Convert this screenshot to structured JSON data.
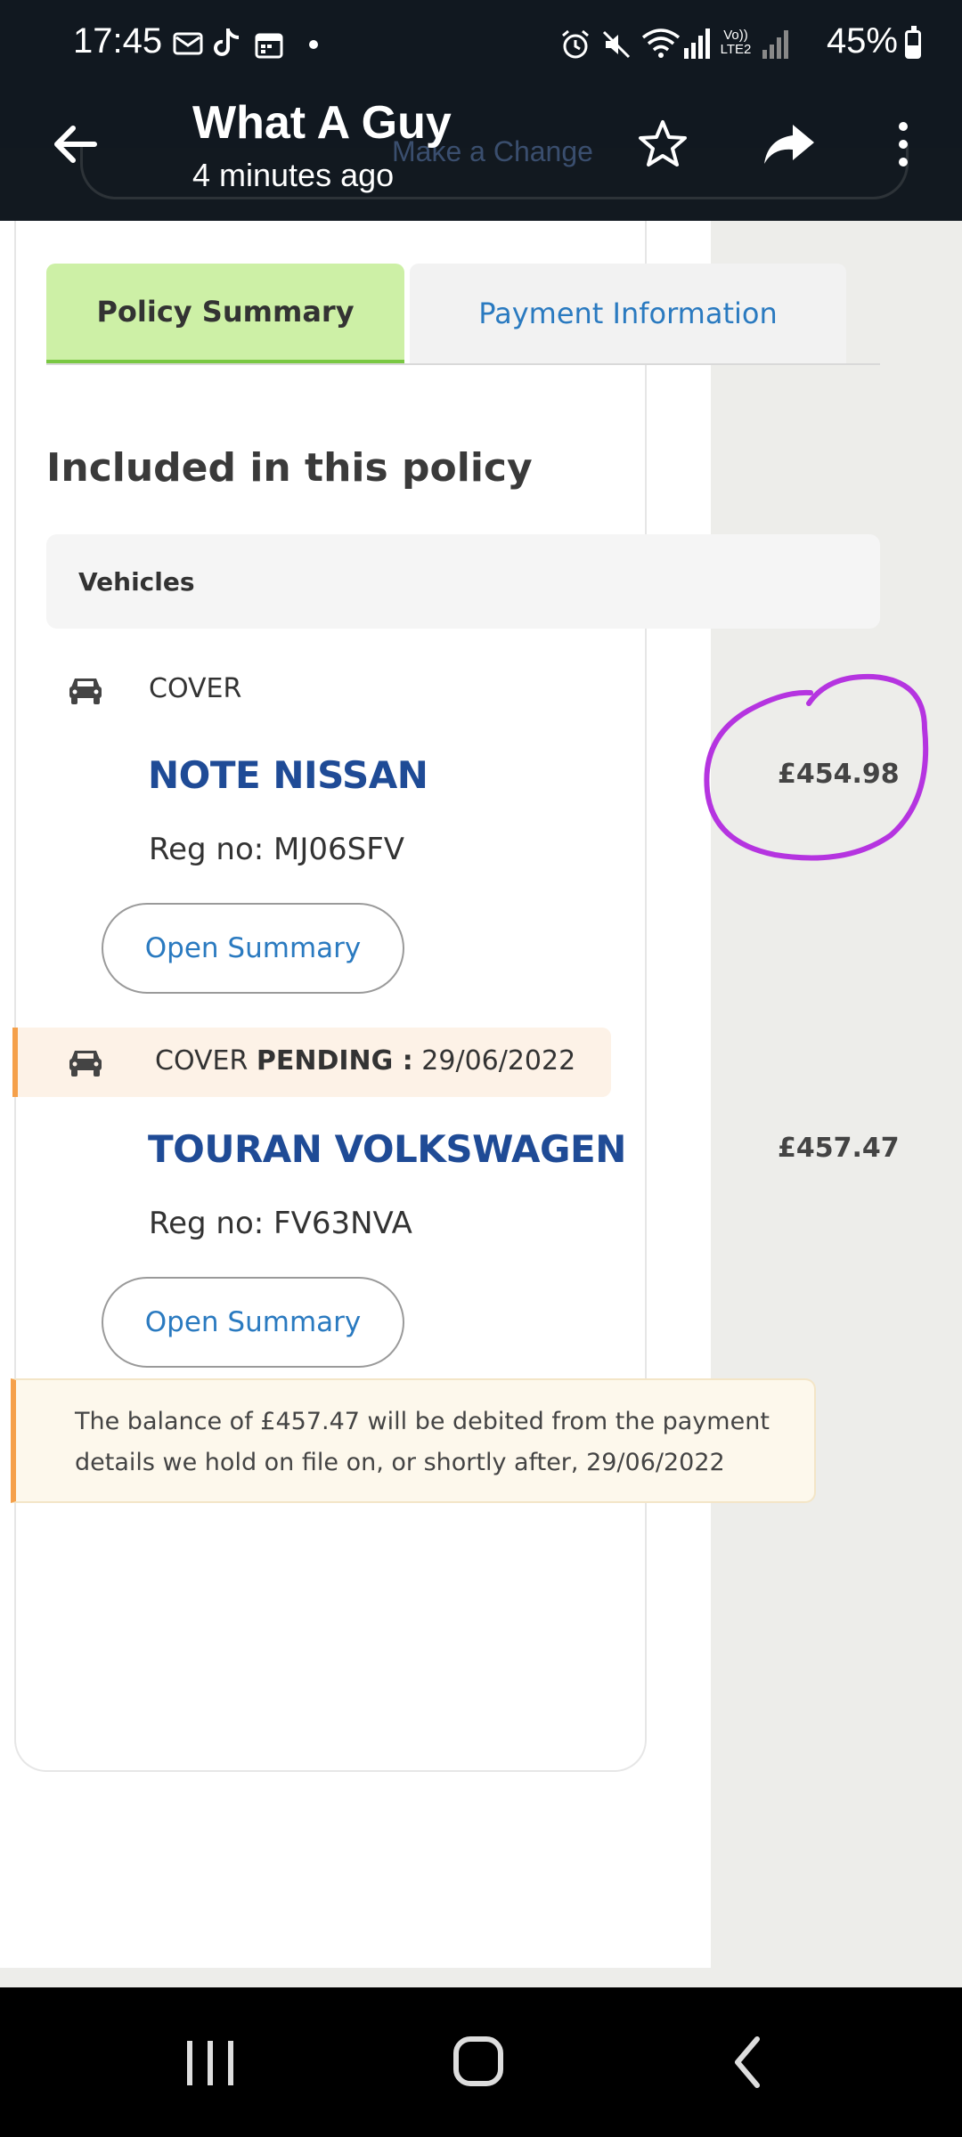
{
  "status_bar": {
    "time": "17:45",
    "battery_percent": "45%",
    "icons": [
      "mail-icon",
      "tiktok-icon",
      "calendar-icon",
      "dot-icon",
      "alarm-icon",
      "mute-icon",
      "wifi-icon",
      "signal-icon",
      "volte-icon",
      "signal-weak-icon",
      "battery-icon"
    ],
    "volte_label": "Vo)) LTE2",
    "battery_level": 0.45
  },
  "header": {
    "title": "What A Guy",
    "subtitle": "4 minutes ago",
    "behind_label": "Make a Change"
  },
  "tabs": [
    {
      "label": "Policy Summary",
      "active": true
    },
    {
      "label": "Payment Information",
      "active": false
    }
  ],
  "main": {
    "section_title": "Included in this policy",
    "vehicles_header": "Vehicles",
    "vehicles": [
      {
        "cover": "COVER",
        "name": "NOTE NISSAN",
        "reg": "Reg no: MJ06SFV",
        "button": "Open Summary",
        "price": "£454.98"
      },
      {
        "cover": "COVER",
        "pending_label": "PENDING :",
        "pending_date": "29/06/2022",
        "name": "TOURAN VOLKSWAGEN",
        "reg": "Reg no: FV63NVA",
        "button": "Open Summary",
        "price": "£457.47"
      }
    ],
    "notice_line1": "The balance of £457.47 will be debited from the payment",
    "notice_line2": "details we hold on file on, or shortly after, 29/06/2022"
  },
  "colors": {
    "active_tab": "#cdf0a6",
    "link_blue": "#2a7ac0",
    "vehicle_blue": "#1f4b96",
    "pending_orange": "#f5a04a",
    "annotation_circle": "#b534e0"
  }
}
